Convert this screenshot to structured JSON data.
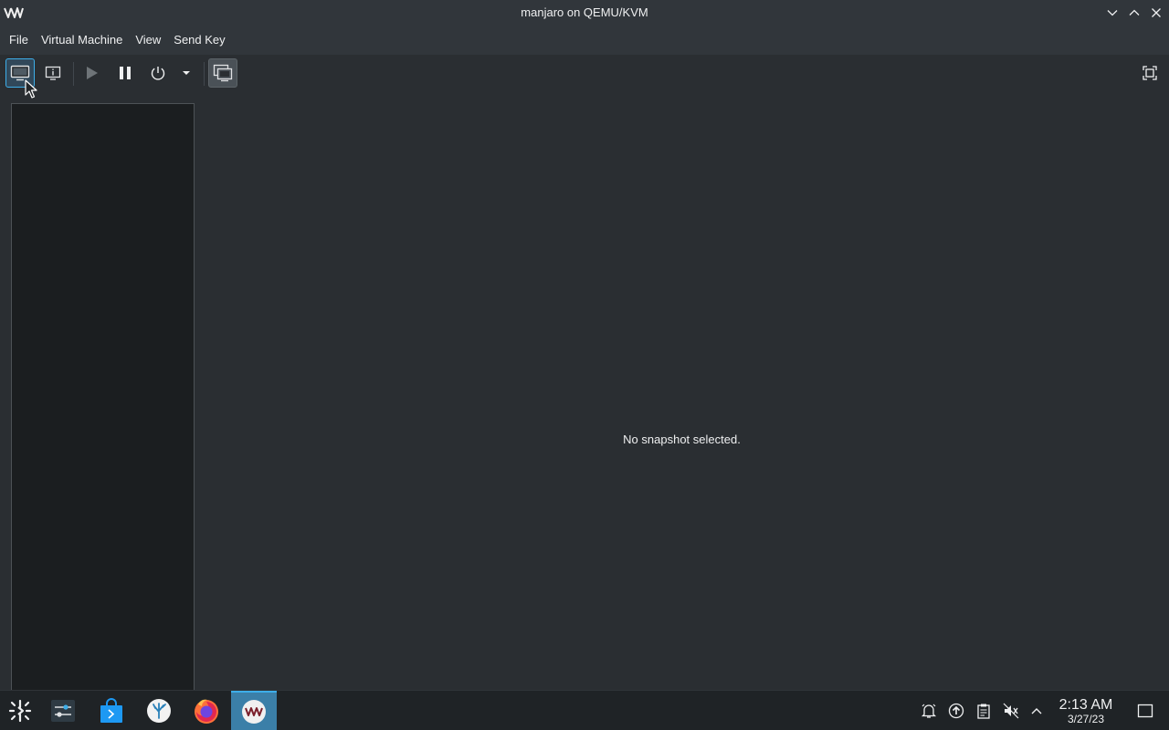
{
  "window": {
    "title": "manjaro on QEMU/KVM",
    "logo_icon": "virt-manager-logo-icon"
  },
  "menubar": {
    "items": [
      {
        "label": "File"
      },
      {
        "label": "Virtual Machine"
      },
      {
        "label": "View"
      },
      {
        "label": "Send Key"
      }
    ]
  },
  "toolbar": {
    "buttons": [
      {
        "name": "console-button",
        "icon": "monitor-icon",
        "active": true
      },
      {
        "name": "details-button",
        "icon": "info-icon"
      },
      {
        "name": "run-button",
        "icon": "play-icon",
        "disabled": true
      },
      {
        "name": "pause-button",
        "icon": "pause-icon"
      },
      {
        "name": "shutdown-button",
        "icon": "power-icon"
      },
      {
        "name": "shutdown-menu-button",
        "icon": "chevron-down-icon"
      },
      {
        "name": "snapshots-button",
        "icon": "snapshots-icon",
        "toggled": true
      },
      {
        "name": "fullscreen-button",
        "icon": "fullscreen-icon"
      }
    ]
  },
  "snapshots": {
    "empty_message": "No snapshot selected."
  },
  "taskbar": {
    "launchers": [
      {
        "name": "app-launcher",
        "icon": "manjaro-launcher-icon"
      },
      {
        "name": "system-settings",
        "icon": "settings-sliders-icon"
      },
      {
        "name": "software-store",
        "icon": "store-bag-icon"
      },
      {
        "name": "file-manager",
        "icon": "coral-app-icon"
      },
      {
        "name": "firefox",
        "icon": "firefox-icon"
      },
      {
        "name": "virt-manager",
        "icon": "virt-manager-icon",
        "active": true
      }
    ],
    "tray": [
      {
        "name": "notifications",
        "icon": "bell-icon"
      },
      {
        "name": "updates",
        "icon": "update-arrow-icon"
      },
      {
        "name": "clipboard",
        "icon": "clipboard-icon"
      },
      {
        "name": "volume",
        "icon": "volume-muted-icon"
      },
      {
        "name": "tray-expand",
        "icon": "chevron-up-icon"
      }
    ],
    "clock": {
      "time": "2:13 AM",
      "date": "3/27/23"
    },
    "show_desktop_icon": "show-desktop-icon"
  },
  "colors": {
    "accent": "#3daee9",
    "window_bg": "#2a2e32",
    "titlebar_bg": "#31363b",
    "panel_bg": "#1b1e20",
    "taskbar_bg": "#1f2326"
  }
}
